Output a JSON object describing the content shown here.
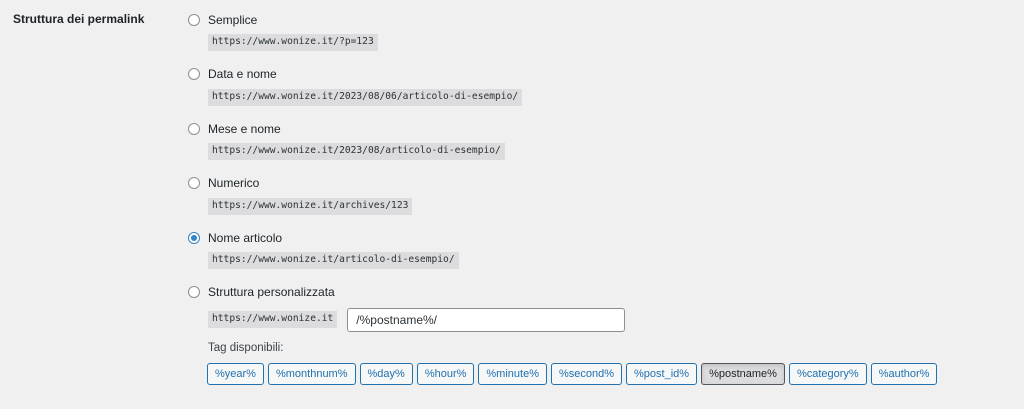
{
  "section": {
    "label": "Struttura dei permalink"
  },
  "options": [
    {
      "label": "Semplice",
      "example": "https://www.wonize.it/?p=123",
      "checked": false
    },
    {
      "label": "Data e nome",
      "example": "https://www.wonize.it/2023/08/06/articolo-di-esempio/",
      "checked": false
    },
    {
      "label": "Mese e nome",
      "example": "https://www.wonize.it/2023/08/articolo-di-esempio/",
      "checked": false
    },
    {
      "label": "Numerico",
      "example": "https://www.wonize.it/archives/123",
      "checked": false
    },
    {
      "label": "Nome articolo",
      "example": "https://www.wonize.it/articolo-di-esempio/",
      "checked": true
    }
  ],
  "custom": {
    "label": "Struttura personalizzata",
    "checked": false,
    "base_url": "https://www.wonize.it",
    "value": "/%postname%/",
    "tags_label": "Tag disponibili:",
    "tags": [
      "%year%",
      "%monthnum%",
      "%day%",
      "%hour%",
      "%minute%",
      "%second%",
      "%post_id%",
      "%postname%",
      "%category%",
      "%author%"
    ],
    "active_tag": "%postname%"
  },
  "colors": {
    "accent": "#2271b1",
    "radio_checked": "#3582c4",
    "background": "#f0f0f1",
    "code_bg": "#dcdcde"
  }
}
